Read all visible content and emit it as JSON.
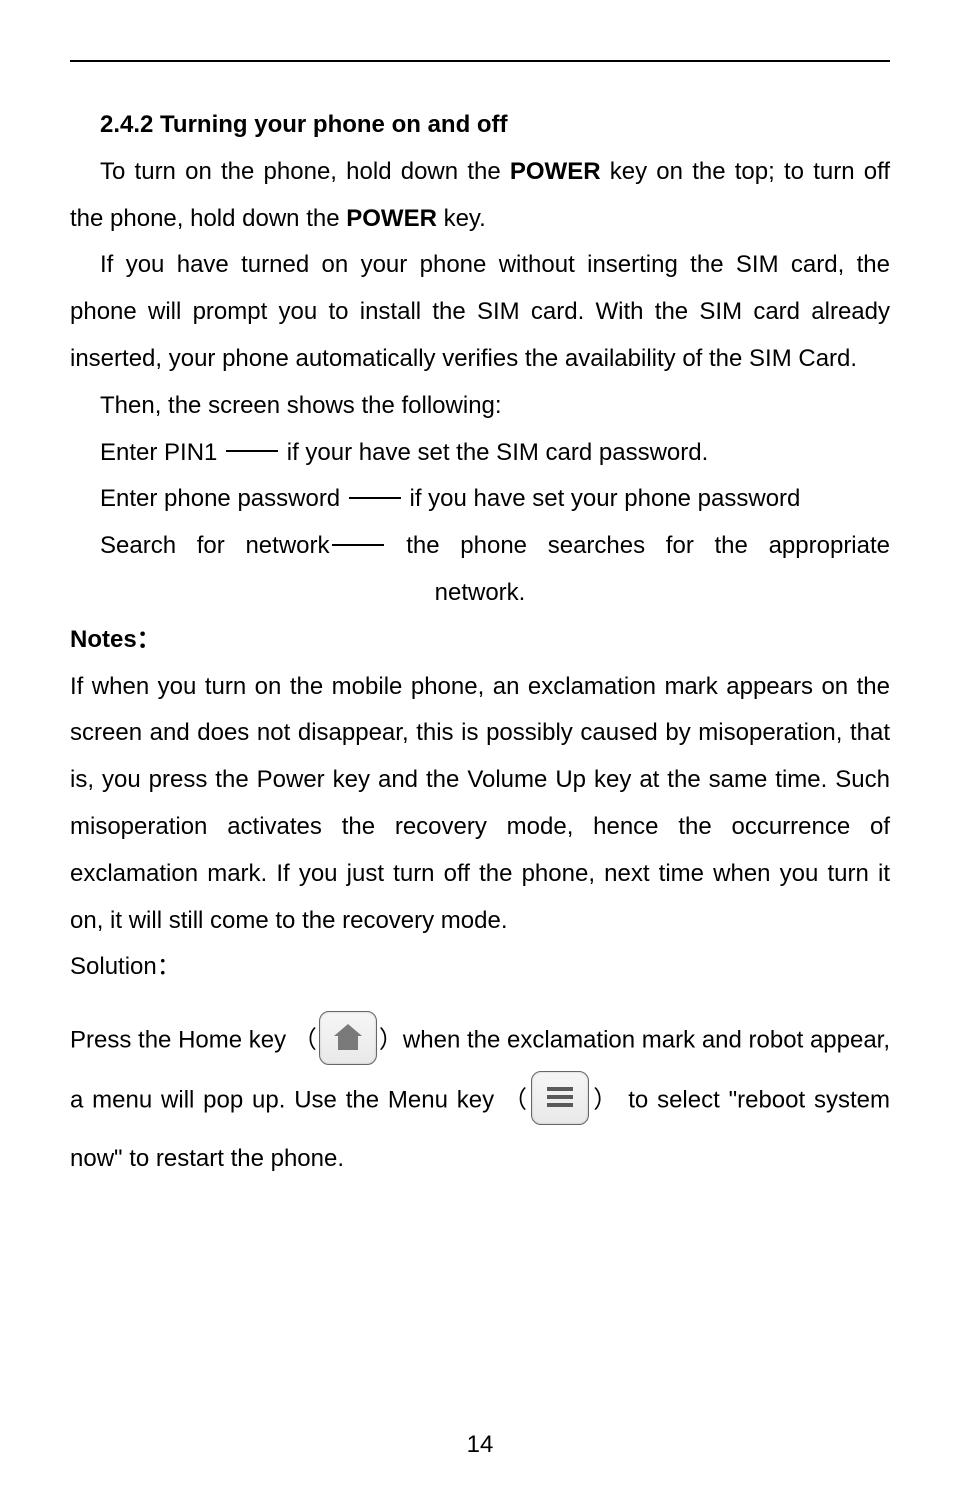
{
  "heading": "2.4.2 Turning your phone on and off",
  "p1_a": "To turn on the phone, hold down the ",
  "p1_b": "POWER",
  "p1_c": " key on the top; to turn off the phone, hold down the ",
  "p1_d": "POWER",
  "p1_e": " key.",
  "p2": "If you have turned on your phone without inserting the SIM card, the phone will prompt you to install the SIM card. With the SIM card already inserted, your phone automatically verifies the availability of the SIM Card.",
  "p3": "Then, the screen shows the following:",
  "l1a": "Enter PIN1 ",
  "l1b": " if your have set the SIM card password.",
  "l2a": "Enter phone password ",
  "l2b": " if you have set your phone password",
  "l3a": "Search for network",
  "l3b": " the phone searches for the appropriate network.",
  "notes": "Notes：",
  "p4": "If when you turn on the mobile phone, an exclamation mark appears on the screen and does not disappear, this is possibly caused by misoperation, that is, you press the Power key and the Volume Up key at the same time. Such misoperation activates the recovery mode, hence the occurrence of exclamation mark. If you just turn off the phone, next time when you turn it on, it will still come to the recovery mode.",
  "solution": "Solution：",
  "p5a": "Press the Home key ",
  "p5_lp": "（",
  "p5_rp": "）",
  "p5b": "when the exclamation mark and robot appear, a menu will pop up. Use the Menu key ",
  "p5c": " to select \"reboot system now\" to restart the phone.",
  "page_no": "14"
}
